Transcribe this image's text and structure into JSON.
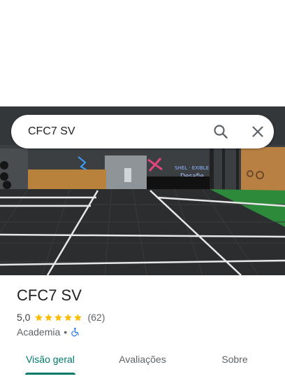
{
  "search": {
    "value": "CFC7 SV"
  },
  "place": {
    "name": "CFC7 SV",
    "rating": "5,0",
    "review_count": "(62)",
    "stars": 5,
    "category": "Academia",
    "separator": "•"
  },
  "tabs": [
    {
      "label": "Visão geral",
      "active": true
    },
    {
      "label": "Avaliações",
      "active": false
    },
    {
      "label": "Sobre",
      "active": false
    }
  ],
  "colors": {
    "accent": "#00796b",
    "star": "#fbbc04",
    "accessibility": "#1a73e8"
  },
  "icons": [
    "search-icon",
    "close-icon",
    "star-icon",
    "wheelchair-icon"
  ]
}
